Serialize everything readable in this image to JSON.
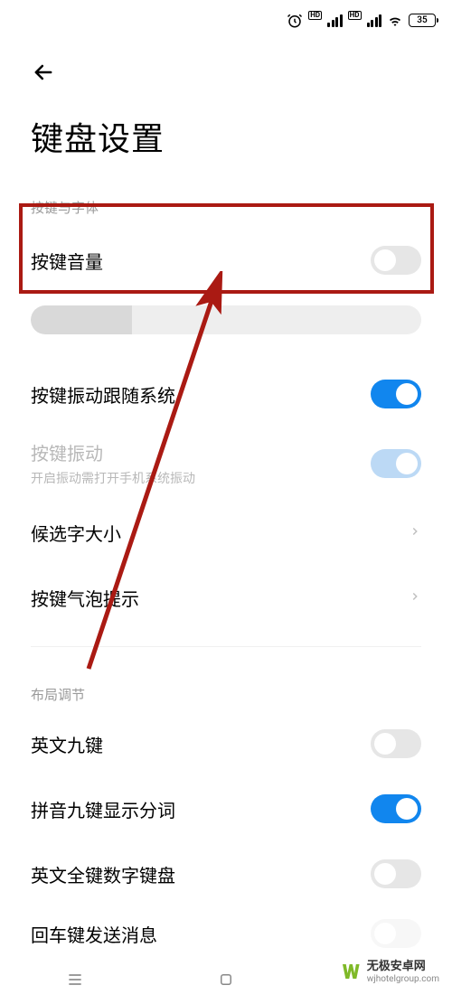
{
  "status": {
    "battery": "35"
  },
  "header": {
    "title": "键盘设置"
  },
  "sections": {
    "keys_font": {
      "header": "按键与字体",
      "key_volume": "按键音量",
      "vibration_follow": "按键振动跟随系统",
      "key_vibration": "按键振动",
      "key_vibration_sub": "开启振动需打开手机系统振动",
      "candidate_size": "候选字大小",
      "bubble_hint": "按键气泡提示"
    },
    "layout": {
      "header": "布局调节",
      "english_nine": "英文九键",
      "pinyin_nine_split": "拼音九键显示分词",
      "english_full_num": "英文全键数字键盘",
      "enter_send": "回车键发送消息"
    }
  },
  "watermark": {
    "title": "无极安卓网",
    "url": "wjhotelgroup.com"
  }
}
